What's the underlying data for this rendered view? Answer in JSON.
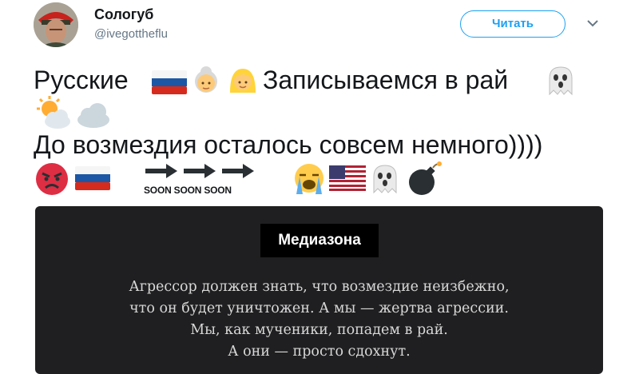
{
  "tweet": {
    "author": {
      "display_name": "Сологуб",
      "handle": "@ivegottheflu",
      "avatar_icon": "user-avatar"
    },
    "follow_label": "Читать",
    "menu_icon": "chevron-down-icon",
    "text_line1": "Русские",
    "text_line1_b": "Записываемся в рай",
    "text_line2": "До возмездия осталось совсем немного))))",
    "soon_label": "SOON SOON SOON",
    "emojis": {
      "flag_russia": "flag-russia-icon",
      "older_woman": "older-woman-icon",
      "woman": "blond-woman-icon",
      "ghost": "ghost-icon",
      "sun_cloud": "sun-behind-cloud-icon",
      "cloud": "cloud-icon",
      "angry": "angry-face-icon",
      "arrows": "right-arrow-icon",
      "crying": "loudly-crying-face-icon",
      "flag_usa": "flag-usa-icon",
      "bomb": "bomb-icon"
    },
    "colors": {
      "accent": "#1da1f2",
      "card_bg": "#1f1f21"
    }
  },
  "card": {
    "badge": "Медиазона",
    "quote_lines": [
      "Агрессор должен знать, что возмездие неизбежно,",
      "что он будет уничтожен. А мы — жертва агрессии.",
      "Мы, как мученики, попадем в рай.",
      "А они — просто сдохнут."
    ]
  }
}
